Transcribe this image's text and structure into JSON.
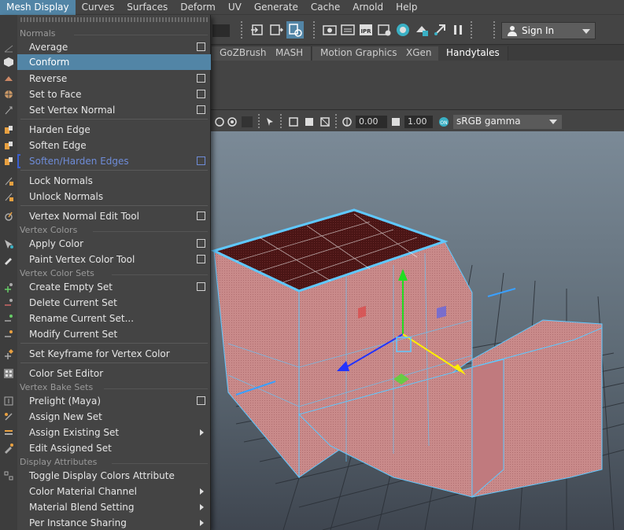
{
  "menubar": {
    "items": [
      {
        "label": "Mesh Display",
        "active": true
      },
      {
        "label": "Curves"
      },
      {
        "label": "Surfaces"
      },
      {
        "label": "Deform"
      },
      {
        "label": "UV"
      },
      {
        "label": "Generate"
      },
      {
        "label": "Cache"
      },
      {
        "label": "Arnold"
      },
      {
        "label": "Help"
      }
    ]
  },
  "statusbar": {
    "signin_label": "Sign In",
    "icons": [
      "move-tool-icon",
      "render-frame-icon",
      "render-settings-icon",
      "render-view-icon",
      "ipr-icon",
      "render-options-icon",
      "hypershade-icon",
      "light-editor-icon",
      "snap-icon",
      "pause-icon",
      "user-icon"
    ]
  },
  "shelf": {
    "tabs": [
      "GoZBrush",
      "MASH",
      "Motion Graphics",
      "XGen",
      "Handytales"
    ],
    "active_tab": "Handytales"
  },
  "panel": {
    "exposure": "0.00",
    "gamma": "1.00",
    "color_space": "sRGB gamma"
  },
  "menu": {
    "sections": {
      "normals": "Normals",
      "vertex_colors": "Vertex Colors",
      "vertex_color_sets": "Vertex Color Sets",
      "vertex_bake_sets": "Vertex Bake Sets",
      "display_attributes": "Display Attributes"
    },
    "items": {
      "average": "Average",
      "conform": "Conform",
      "reverse": "Reverse",
      "set_to_face": "Set to Face",
      "set_vertex_normal": "Set Vertex Normal",
      "harden_edge": "Harden Edge",
      "soften_edge": "Soften Edge",
      "soften_harden_edges": "Soften/Harden Edges",
      "lock_normals": "Lock Normals",
      "unlock_normals": "Unlock Normals",
      "vertex_normal_edit_tool": "Vertex Normal Edit Tool",
      "apply_color": "Apply Color",
      "paint_vertex_color_tool": "Paint Vertex Color Tool",
      "create_empty_set": "Create Empty Set",
      "delete_current_set": "Delete Current Set",
      "rename_current_set": "Rename Current Set...",
      "modify_current_set": "Modify Current Set",
      "set_keyframe_vertex_color": "Set Keyframe for Vertex Color",
      "color_set_editor": "Color Set Editor",
      "prelight": "Prelight (Maya)",
      "assign_new_set": "Assign New Set",
      "assign_existing_set": "Assign Existing Set",
      "edit_assigned_set": "Edit Assigned Set",
      "toggle_display_colors": "Toggle Display Colors Attribute",
      "color_material_channel": "Color Material Channel",
      "material_blend_setting": "Material Blend Setting",
      "per_instance_sharing": "Per Instance Sharing"
    },
    "highlighted": "Conform",
    "accent": "#5285a6"
  },
  "viewport": {
    "mesh_color": "#c98a8a",
    "wire_color": "#5fc8ff",
    "background_top": "#7b8a97",
    "background_bottom": "#3f4650"
  }
}
